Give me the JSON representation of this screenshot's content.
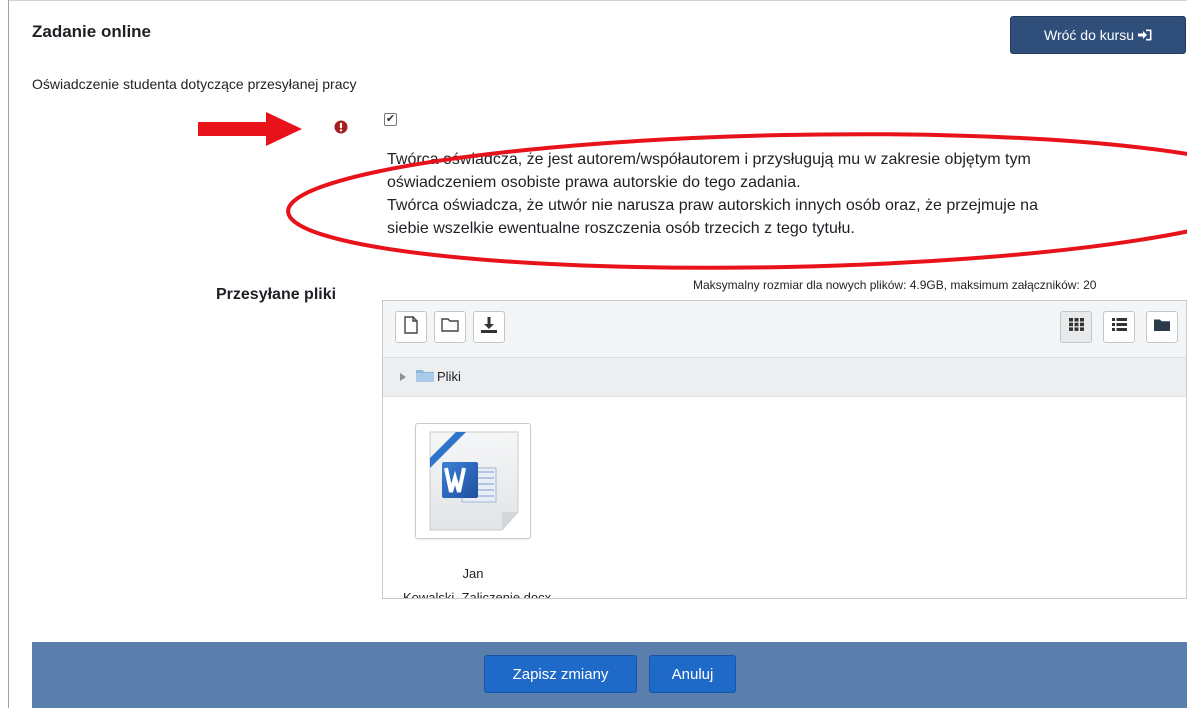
{
  "header": {
    "title": "Zadanie online",
    "back_button_label": "Wróć do kursu"
  },
  "statement": {
    "heading": "Oświadczenie studenta  dotyczące przesyłanej pracy",
    "checkbox_checked": true,
    "lines": [
      "Twórca oświadcza, że jest autorem/współautorem i przysługują mu w zakresie objętym tym",
      "oświadczeniem osobiste prawa autorskie do tego zadania.",
      "Twórca oświadcza, że utwór nie narusza praw autorskich innych osób oraz, że przejmuje na",
      "siebie wszelkie ewentualne roszczenia osób trzecich z tego tytułu."
    ]
  },
  "files": {
    "label": "Przesyłane pliki",
    "max_size_text": "Maksymalny rozmiar dla nowych plików: 4.9GB, maksimum załączników: 20",
    "toolbar_icons": [
      "add-file-icon",
      "create-folder-icon",
      "download-icon"
    ],
    "view_icons": [
      "grid-view-icon",
      "list-view-icon",
      "tree-view-icon"
    ],
    "path_label": "Pliki",
    "items": [
      {
        "name": "Jan",
        "name_line2": "Kowalski_Zaliczenie.docx",
        "icon": "word-document-icon"
      }
    ]
  },
  "footer": {
    "save_label": "Zapisz zmiany",
    "cancel_label": "Anuluj"
  },
  "colors": {
    "primary_button": "#1f69c8",
    "back_button": "#2f4f7a",
    "footer_bar": "#5b7fad",
    "annotation_red": "#e8121b",
    "required_icon": "#a61e1e"
  }
}
